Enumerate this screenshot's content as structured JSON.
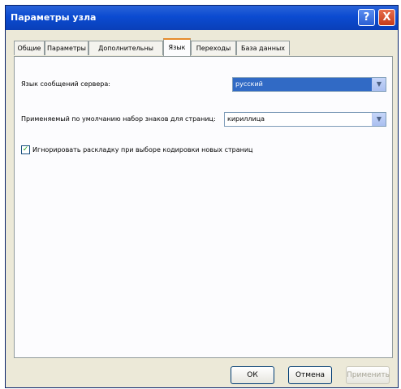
{
  "window": {
    "title": "Параметры узла"
  },
  "titlebar": {
    "help_glyph": "?",
    "close_glyph": "X"
  },
  "tabs": [
    {
      "label": "Общие"
    },
    {
      "label": "Параметры"
    },
    {
      "label": "Дополнительны"
    },
    {
      "label": "Язык"
    },
    {
      "label": "Переходы"
    },
    {
      "label": "База данных"
    }
  ],
  "panel": {
    "server_lang_label": "Язык сообщений сервера:",
    "server_lang_value": "русский",
    "charset_label": "Применяемый по умолчанию набор знаков для страниц:",
    "charset_value": "кириллица",
    "ignore_label": "Игнорировать раскладку при выборе кодировки новых страниц",
    "ignore_checked": true
  },
  "buttons": {
    "ok": "ОК",
    "cancel": "Отмена",
    "apply": "Применить"
  }
}
